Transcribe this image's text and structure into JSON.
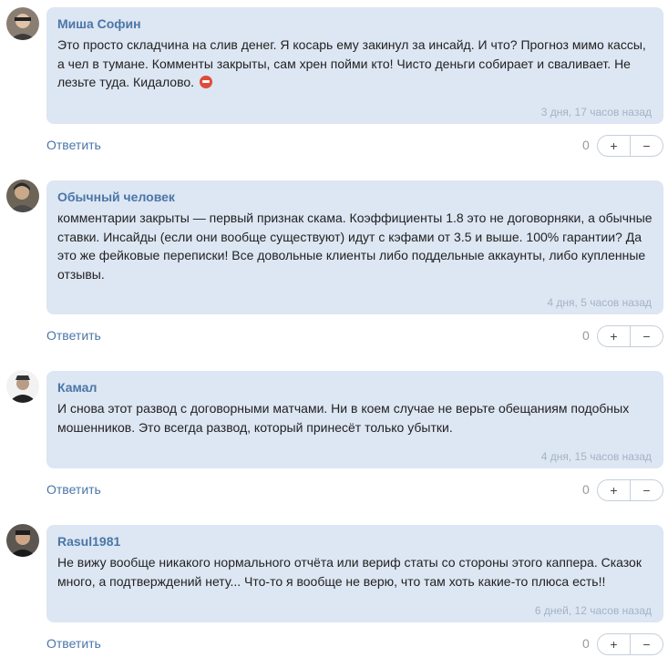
{
  "comments": [
    {
      "author": "Миша Софин",
      "text": "Это просто складчина на слив денег. Я косарь ему закинул за инсайд. И что? Прогноз мимо кассы, а чел в тумане. Комменты закрыты, сам хрен пойми кто! Чисто деньги собирает и сваливает. Не лезьте туда. Кидалово.",
      "emoji_icon": "angry-face-icon",
      "date": "3 дня, 17 часов назад",
      "reply_label": "Ответить",
      "score": "0",
      "upvote_label": "+",
      "downvote_label": "−"
    },
    {
      "author": "Обычный человек",
      "text": "комментарии закрыты — первый признак скама. Коэффициенты 1.8 это не договорняки, а обычные ставки. Инсайды (если они вообще существуют) идут с кэфами от 3.5 и выше. 100% гарантии? Да это же фейковые переписки! Все довольные клиенты либо поддельные аккаунты, либо купленные отзывы.",
      "date": "4 дня, 5 часов назад",
      "reply_label": "Ответить",
      "score": "0",
      "upvote_label": "+",
      "downvote_label": "−"
    },
    {
      "author": "Камал",
      "text": "И снова этот развод с договорными матчами. Ни в коем случае не верьте обещаниям подобных мошенников. Это всегда развод, который принесёт только убытки.",
      "date": "4 дня, 15 часов назад",
      "reply_label": "Ответить",
      "score": "0",
      "upvote_label": "+",
      "downvote_label": "−"
    },
    {
      "author": "Rasul1981",
      "text": "Не вижу вообще никакого нормального отчёта или вериф статы со стороны этого каппера. Сказок много, а подтверждений нету... Что-то я вообще не верю, что там хоть какие-то плюса есть!!",
      "date": "6 дней, 12 часов назад",
      "reply_label": "Ответить",
      "score": "0",
      "upvote_label": "+",
      "downvote_label": "−"
    }
  ]
}
